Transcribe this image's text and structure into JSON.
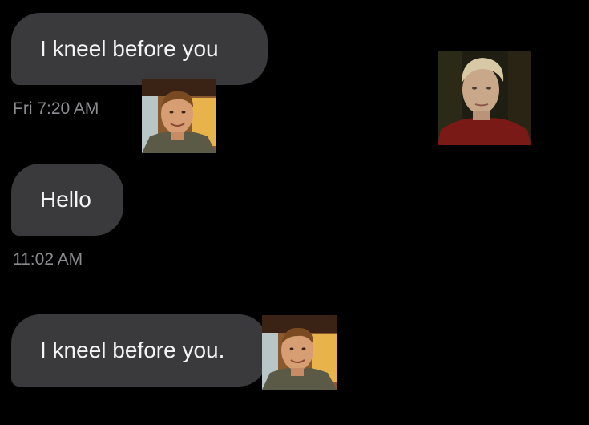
{
  "conversation": {
    "messages": [
      {
        "text": "I kneel before you",
        "timestamp": "Fri 7:20 AM"
      },
      {
        "text": "Hello",
        "timestamp": "11:02 AM"
      },
      {
        "text": "I kneel before you.",
        "timestamp": ""
      }
    ]
  },
  "stickers": [
    {
      "icon": "smiling-man-photo"
    },
    {
      "icon": "blond-man-photo"
    },
    {
      "icon": "smiling-man-photo"
    }
  ],
  "colors": {
    "background": "#000000",
    "bubble": "#3a3a3d",
    "bubble_text": "#f4f4f6",
    "timestamp": "#8b8b90"
  }
}
